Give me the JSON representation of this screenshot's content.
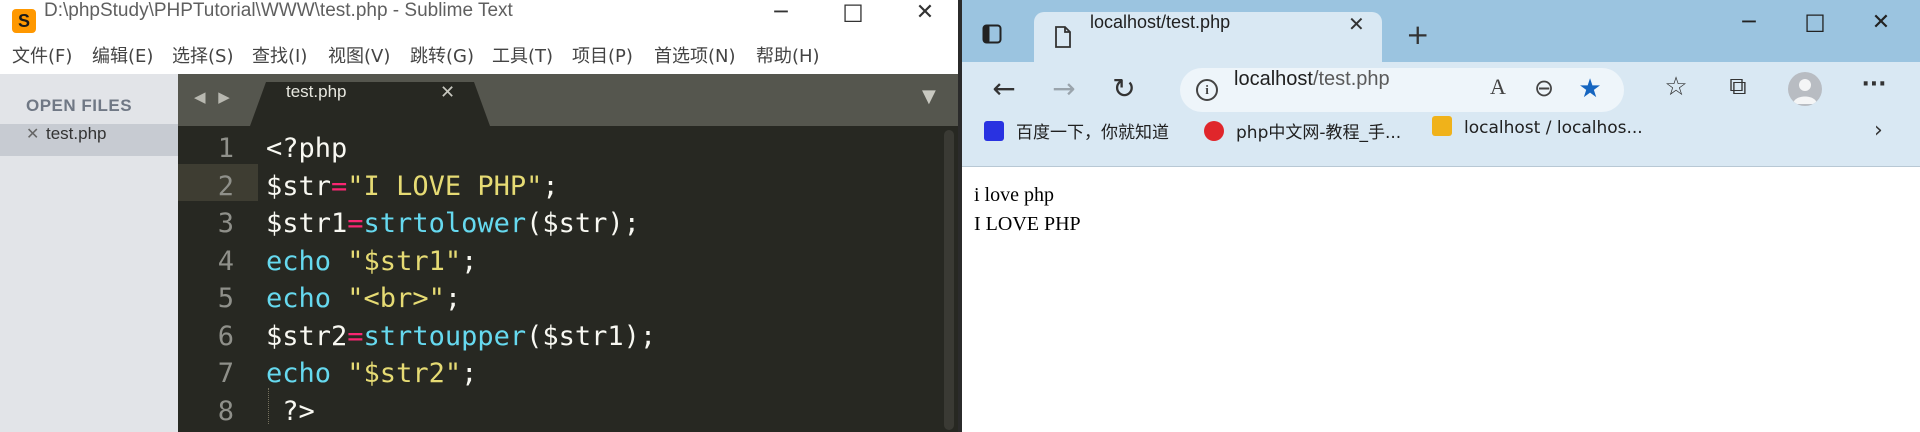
{
  "sublime": {
    "title": "D:\\phpStudy\\PHPTutorial\\WWW\\test.php - Sublime Text",
    "logo_letter": "S",
    "window_controls": {
      "minimize": "─",
      "maximize": "☐",
      "close": "✕"
    },
    "menu": [
      "文件(F)",
      "编辑(E)",
      "选择(S)",
      "查找(I)",
      "视图(V)",
      "跳转(G)",
      "工具(T)",
      "项目(P)",
      "首选项(N)",
      "帮助(H)"
    ],
    "sidebar": {
      "header": "OPEN FILES",
      "files": [
        {
          "name": "test.php",
          "close": "✕"
        }
      ]
    },
    "tab_nav": "◀ ▶",
    "tabs": [
      {
        "label": "test.php",
        "close": "✕"
      }
    ],
    "tab_dropdown": "▼",
    "line_numbers": [
      "1",
      "2",
      "3",
      "4",
      "5",
      "6",
      "7",
      "8"
    ],
    "current_line": 2,
    "code": {
      "l1": [
        "<?php"
      ],
      "l2": [
        "$str",
        "=",
        "\"I LOVE PHP\"",
        ";"
      ],
      "l3": [
        "$str1",
        "=",
        "strtolower",
        "($str);"
      ],
      "l4": [
        "echo",
        " ",
        "\"$str1\"",
        ";"
      ],
      "l5": [
        "echo",
        " ",
        "\"<br>\"",
        ";"
      ],
      "l6": [
        "$str2",
        "=",
        "strtoupper",
        "($str1);"
      ],
      "l7": [
        "echo",
        " ",
        "\"$str2\"",
        ";"
      ],
      "l8": [
        " ?>"
      ]
    },
    "colors": {
      "background": "#272822",
      "string": "#e6db74",
      "keyword": "#f92672",
      "function": "#66d9ef",
      "text": "#f8f8f2"
    }
  },
  "browser": {
    "tab": {
      "title": "localhost/test.php",
      "close": "✕"
    },
    "new_tab": "+",
    "window_controls": {
      "minimize": "─",
      "maximize": "☐",
      "close": "✕"
    },
    "nav": {
      "back": "←",
      "forward": "→",
      "refresh": "↻"
    },
    "address": {
      "host": "localhost",
      "path": "/test.php"
    },
    "address_icons": {
      "read_aloud": "A",
      "zoom": "⊖",
      "favorite": "★"
    },
    "toolbar_icons": {
      "favorites": "☆",
      "collections": "⧉",
      "more": "···"
    },
    "favorites": [
      {
        "label": "百度一下，你就知道",
        "icon": "baidu-icon"
      },
      {
        "label": "php中文网-教程_手...",
        "icon": "php-cn-icon"
      },
      {
        "label": "localhost / localhos...",
        "icon": "phpmyadmin-icon"
      }
    ],
    "favorites_more": "›",
    "page_output": [
      "i love php",
      "I LOVE PHP"
    ],
    "colors": {
      "tabstrip": "#9bc4e0",
      "toolbar": "#d9e8f3",
      "favorite_star": "#1565c0"
    }
  }
}
